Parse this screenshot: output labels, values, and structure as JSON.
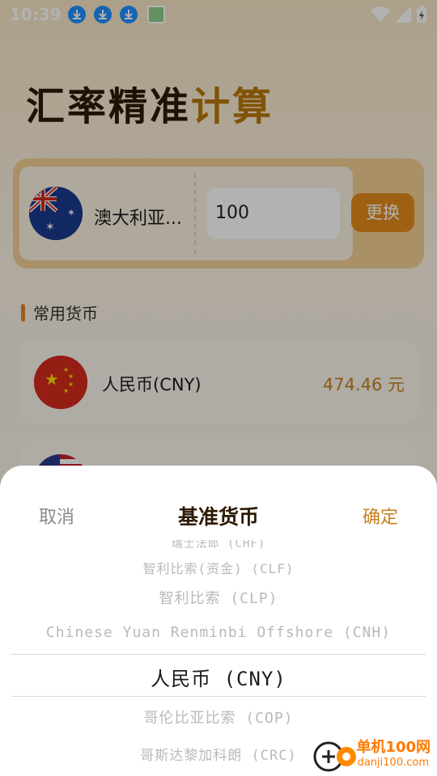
{
  "status_bar": {
    "time": "10:39"
  },
  "app": {
    "title_part1": "汇率精准",
    "title_part2": "计算",
    "base_currency_name": "澳大利亚...",
    "amount_value": "100",
    "swap_label": "更换",
    "section_title": "常用货币",
    "rows": [
      {
        "name": "人民币(CNY)",
        "value": "474.46 元"
      }
    ]
  },
  "sheet": {
    "cancel_label": "取消",
    "title": "基准货币",
    "confirm_label": "确定",
    "options": [
      "瑞士法郎 (CHF)",
      "智利比索(资金) (CLF)",
      "智利比索 (CLP)",
      "Chinese Yuan Renminbi Offshore (CNH)",
      "人民币 (CNY)",
      "哥伦比亚比索 (COP)",
      "哥斯达黎加科朗 (CRC)"
    ],
    "selected_index": 4
  },
  "watermark": {
    "line1": "单机100网",
    "line2": "danji100.com"
  }
}
